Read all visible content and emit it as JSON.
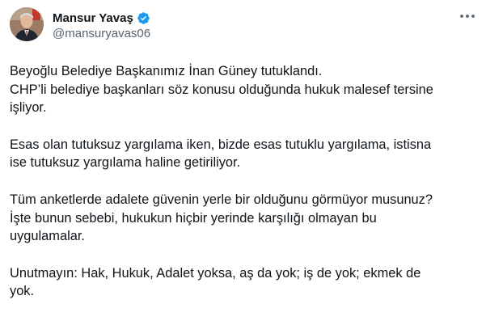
{
  "author": {
    "display_name": "Mansur Yavaş",
    "handle": "@mansuryavas06",
    "verified": true,
    "avatar_icon": "profile-photo",
    "verified_color": "#1d9bf0"
  },
  "menu": {
    "icon": "more-horizontal-icon"
  },
  "tweet": {
    "lines_p1": [
      "Beyoğlu Belediye Başkanımız İnan Güney tutuklandı.",
      "CHP’li belediye başkanları söz konusu olduğunda hukuk malesef tersine",
      "işliyor."
    ],
    "lines_p2": [
      "Esas olan tutuksuz yargılama iken, bizde esas tutuklu yargılama, istisna",
      "ise tutuksuz yargılama haline getiriliyor."
    ],
    "lines_p3": [
      "Tüm anketlerde adalete güvenin yerle bir olduğunu görmüyor musunuz?",
      "İşte bunun sebebi, hukukun hiçbir yerinde karşılığı olmayan bu",
      "uygulamalar."
    ],
    "lines_p4": [
      "Unutmayın: Hak, Hukuk, Adalet yoksa, aş da yok; iş de yok; ekmek de",
      "yok."
    ]
  }
}
